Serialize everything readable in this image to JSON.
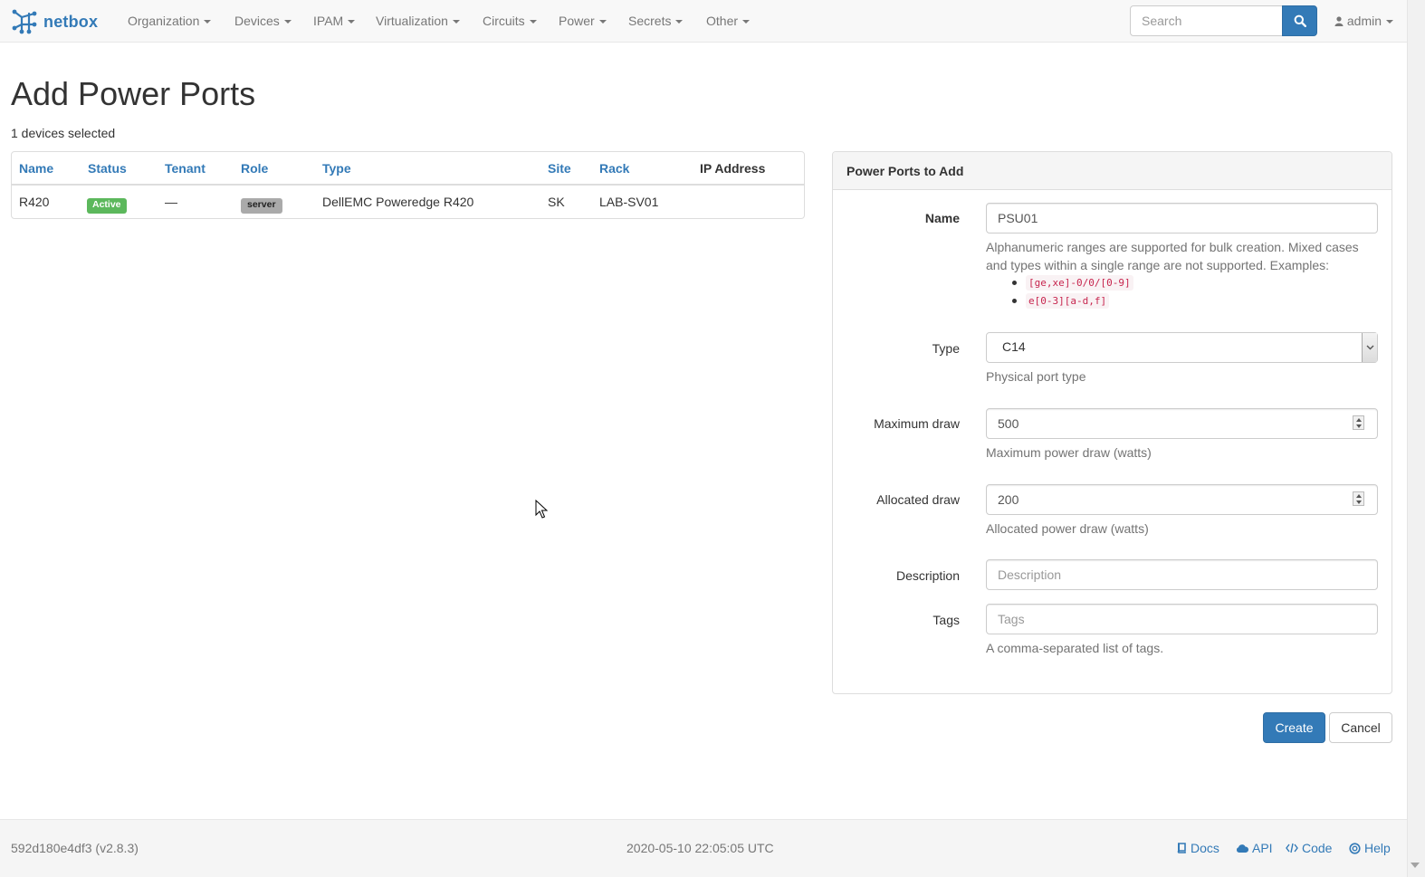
{
  "brand": {
    "name": "netbox",
    "color": "#337ab7"
  },
  "nav": {
    "items": [
      {
        "label": "Organization"
      },
      {
        "label": "Devices"
      },
      {
        "label": "IPAM"
      },
      {
        "label": "Virtualization"
      },
      {
        "label": "Circuits"
      },
      {
        "label": "Power"
      },
      {
        "label": "Secrets"
      },
      {
        "label": "Other"
      }
    ],
    "search_placeholder": "Search",
    "search_icon": "search-icon",
    "user": {
      "name": "admin",
      "icon": "user-icon"
    }
  },
  "page": {
    "title": "Add Power Ports",
    "selected_text": "1 devices selected"
  },
  "devices_table": {
    "columns": [
      "Name",
      "Status",
      "Tenant",
      "Role",
      "Type",
      "Site",
      "Rack",
      "IP Address"
    ],
    "rows": [
      {
        "name": "R420",
        "status": "Active",
        "status_color": "#5cb85c",
        "tenant": "—",
        "role": "server",
        "type": "DellEMC Poweredge R420",
        "site": "SK",
        "rack": "LAB-SV01",
        "ip_address": ""
      }
    ]
  },
  "form": {
    "panel_title": "Power Ports to Add",
    "name": {
      "label": "Name",
      "value": "PSU01",
      "help": "Alphanumeric ranges are supported for bulk creation. Mixed cases and types within a single range are not supported. Examples:",
      "examples": [
        "[ge,xe]-0/0/[0-9]",
        "e[0-3][a-d,f]"
      ]
    },
    "type": {
      "label": "Type",
      "value": "C14",
      "help": "Physical port type"
    },
    "maximum_draw": {
      "label": "Maximum draw",
      "value": "500",
      "help": "Maximum power draw (watts)"
    },
    "allocated_draw": {
      "label": "Allocated draw",
      "value": "200",
      "help": "Allocated power draw (watts)"
    },
    "description": {
      "label": "Description",
      "value": "",
      "placeholder": "Description"
    },
    "tags": {
      "label": "Tags",
      "value": "",
      "placeholder": "Tags",
      "help": "A comma-separated list of tags."
    },
    "create_label": "Create",
    "cancel_label": "Cancel"
  },
  "footer": {
    "version": "592d180e4df3 (v2.8.3)",
    "timestamp": "2020-05-10 22:05:05 UTC",
    "links": [
      {
        "label": "Docs",
        "icon": "book-icon"
      },
      {
        "label": "API",
        "icon": "cloud-icon"
      },
      {
        "label": "Code",
        "icon": "code-icon"
      },
      {
        "label": "Help",
        "icon": "lifebuoy-icon"
      }
    ]
  }
}
